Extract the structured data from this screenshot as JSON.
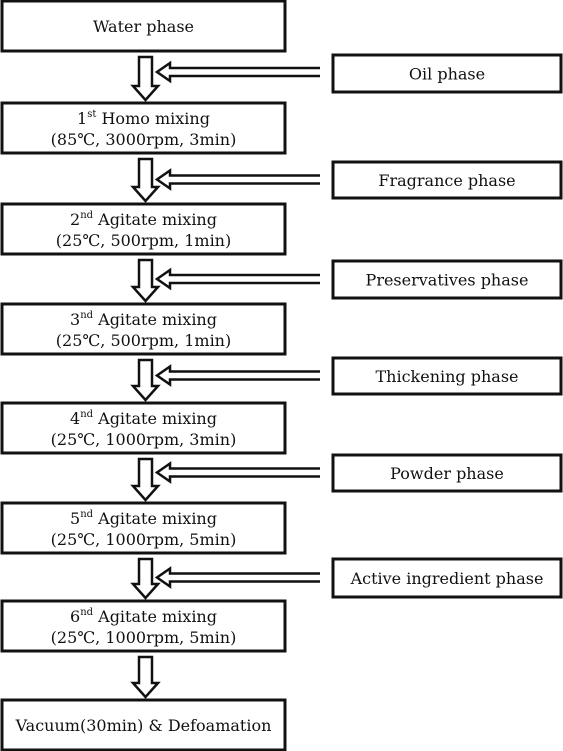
{
  "colors": {
    "stroke": "#111111",
    "background": "#ffffff"
  },
  "steps": [
    {
      "label": "Water phase"
    },
    {
      "ord": "1",
      "sup": "st",
      "title": " Homo mixing",
      "params": "(85℃, 3000rpm, 3min)"
    },
    {
      "ord": "2",
      "sup": "nd",
      "title": " Agitate mixing",
      "params": "(25℃, 500rpm, 1min)"
    },
    {
      "ord": "3",
      "sup": "nd",
      "title": " Agitate mixing",
      "params": "(25℃, 500rpm, 1min)"
    },
    {
      "ord": "4",
      "sup": "nd",
      "title": " Agitate mixing",
      "params": "(25℃, 1000rpm, 3min)"
    },
    {
      "ord": "5",
      "sup": "nd",
      "title": " Agitate mixing",
      "params": "(25℃, 1000rpm, 5min)"
    },
    {
      "ord": "6",
      "sup": "nd",
      "title": " Agitate mixing",
      "params": "(25℃, 1000rpm, 5min)"
    },
    {
      "label": "Vacuum(30min) & Defoamation"
    }
  ],
  "inputs": [
    {
      "label": "Oil phase"
    },
    {
      "label": "Fragrance phase"
    },
    {
      "label": "Preservatives phase"
    },
    {
      "label": "Thickening phase"
    },
    {
      "label": "Powder phase"
    },
    {
      "label": "Active ingredient phase"
    }
  ]
}
